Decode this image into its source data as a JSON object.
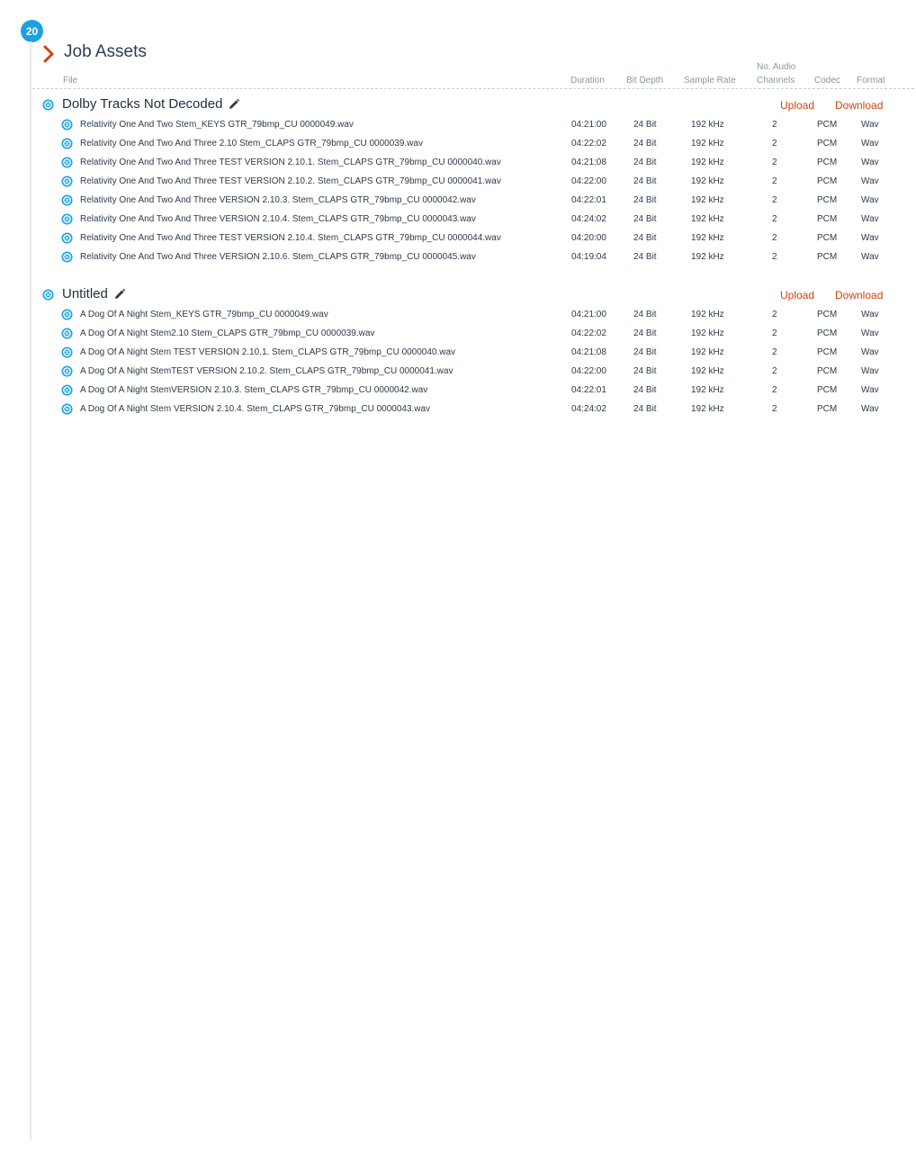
{
  "step_badge": "20",
  "title": "Job Assets",
  "columns": {
    "file": "File",
    "duration": "Duration",
    "bit_depth": "Bit Depth",
    "sample_rate": "Sample Rate",
    "channels_line1": "No. Audio",
    "channels_line2": "Channels",
    "codec": "Codec",
    "format": "Format"
  },
  "colors": {
    "accent": "#1ba1e2",
    "action": "#d4400c",
    "chevron": "#d4400c"
  },
  "icons": {
    "group": "close-circle-icon",
    "row": "close-circle-icon",
    "edit": "pencil-icon",
    "header": "chevron-right-icon"
  },
  "groups": [
    {
      "name": "Dolby Tracks Not Decoded",
      "upload": "Upload",
      "download": "Download",
      "files": [
        {
          "file": "Relativity One And Two Stem_KEYS GTR_79bmp_CU 0000049.wav",
          "duration": "04:21:00",
          "bit": "24 Bit",
          "rate": "192 kHz",
          "channels": "2",
          "codec": "PCM",
          "format": "Wav"
        },
        {
          "file": "Relativity One And Two And Three 2.10 Stem_CLAPS GTR_79bmp_CU 0000039.wav",
          "duration": "04:22:02",
          "bit": "24 Bit",
          "rate": "192 kHz",
          "channels": "2",
          "codec": "PCM",
          "format": "Wav"
        },
        {
          "file": "Relativity One And Two And Three TEST VERSION 2.10.1. Stem_CLAPS GTR_79bmp_CU 0000040.wav",
          "duration": "04:21:08",
          "bit": "24 Bit",
          "rate": "192 kHz",
          "channels": "2",
          "codec": "PCM",
          "format": "Wav"
        },
        {
          "file": "Relativity One And Two And Three TEST VERSION 2.10.2. Stem_CLAPS GTR_79bmp_CU 0000041.wav",
          "duration": "04:22:00",
          "bit": "24 Bit",
          "rate": "192 kHz",
          "channels": "2",
          "codec": "PCM",
          "format": "Wav"
        },
        {
          "file": "Relativity One And Two And Three VERSION 2.10.3. Stem_CLAPS GTR_79bmp_CU 0000042.wav",
          "duration": "04:22:01",
          "bit": "24 Bit",
          "rate": "192 kHz",
          "channels": "2",
          "codec": "PCM",
          "format": "Wav"
        },
        {
          "file": "Relativity One And Two And Three VERSION 2.10.4. Stem_CLAPS GTR_79bmp_CU 0000043.wav",
          "duration": "04:24:02",
          "bit": "24 Bit",
          "rate": "192 kHz",
          "channels": "2",
          "codec": "PCM",
          "format": "Wav"
        },
        {
          "file": "Relativity One And Two And Three TEST VERSION 2.10.4. Stem_CLAPS GTR_79bmp_CU 0000044.wav",
          "duration": "04:20:00",
          "bit": "24 Bit",
          "rate": "192 kHz",
          "channels": "2",
          "codec": "PCM",
          "format": "Wav"
        },
        {
          "file": "Relativity One And Two And Three VERSION 2.10.6. Stem_CLAPS GTR_79bmp_CU 0000045.wav",
          "duration": "04:19:04",
          "bit": "24 Bit",
          "rate": "192 kHz",
          "channels": "2",
          "codec": "PCM",
          "format": "Wav"
        }
      ]
    },
    {
      "name": "Untitled",
      "upload": "Upload",
      "download": "Download",
      "files": [
        {
          "file": "A Dog Of A Night Stem_KEYS GTR_79bmp_CU 0000049.wav",
          "duration": "04:21:00",
          "bit": "24 Bit",
          "rate": "192 kHz",
          "channels": "2",
          "codec": "PCM",
          "format": "Wav"
        },
        {
          "file": "A Dog Of A Night Stem2.10 Stem_CLAPS GTR_79bmp_CU 0000039.wav",
          "duration": "04:22:02",
          "bit": "24 Bit",
          "rate": "192 kHz",
          "channels": "2",
          "codec": "PCM",
          "format": "Wav"
        },
        {
          "file": "A Dog Of A Night Stem TEST VERSION 2.10.1. Stem_CLAPS GTR_79bmp_CU 0000040.wav",
          "duration": "04:21:08",
          "bit": "24 Bit",
          "rate": "192 kHz",
          "channels": "2",
          "codec": "PCM",
          "format": "Wav"
        },
        {
          "file": "A Dog Of A Night StemTEST VERSION 2.10.2. Stem_CLAPS GTR_79bmp_CU 0000041.wav",
          "duration": "04:22:00",
          "bit": "24 Bit",
          "rate": "192 kHz",
          "channels": "2",
          "codec": "PCM",
          "format": "Wav"
        },
        {
          "file": "A Dog Of A Night StemVERSION 2.10.3. Stem_CLAPS GTR_79bmp_CU 0000042.wav",
          "duration": "04:22:01",
          "bit": "24 Bit",
          "rate": "192 kHz",
          "channels": "2",
          "codec": "PCM",
          "format": "Wav"
        },
        {
          "file": "A Dog Of A Night Stem VERSION 2.10.4. Stem_CLAPS GTR_79bmp_CU 0000043.wav",
          "duration": "04:24:02",
          "bit": "24 Bit",
          "rate": "192 kHz",
          "channels": "2",
          "codec": "PCM",
          "format": "Wav"
        }
      ]
    }
  ]
}
